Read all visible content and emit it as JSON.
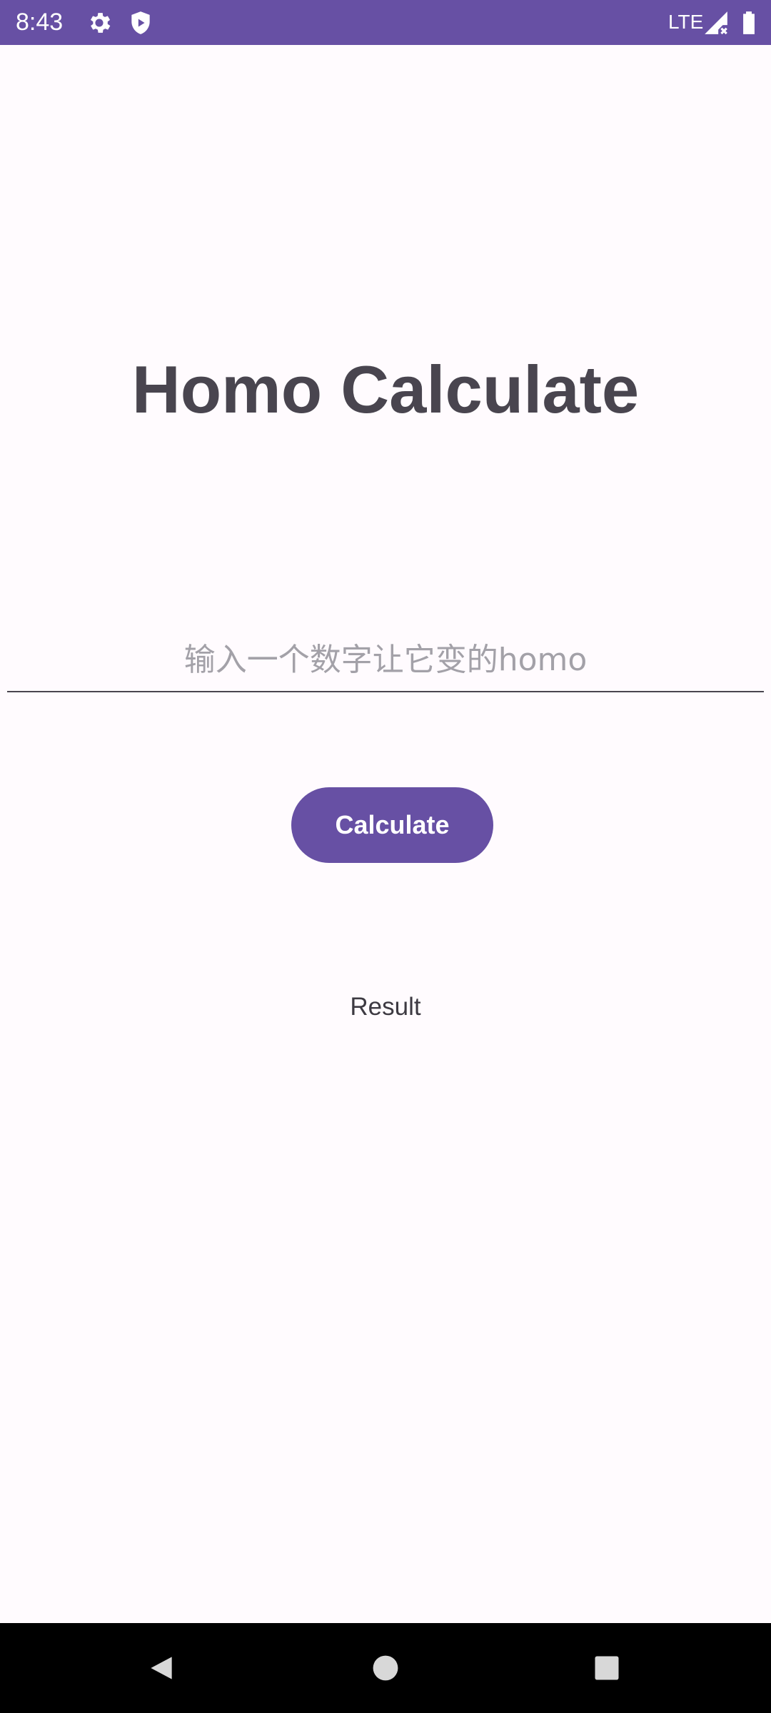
{
  "status_bar": {
    "time": "8:43",
    "network": "LTE",
    "icons": [
      "gear-icon",
      "shield-play-icon",
      "signal-icon",
      "battery-icon"
    ]
  },
  "main": {
    "title": "Homo Calculate",
    "input": {
      "placeholder": "输入一个数字让它变的homo",
      "value": ""
    },
    "calculate_label": "Calculate",
    "result_text": "Result"
  },
  "nav_bar": {
    "icons": [
      "back-icon",
      "home-icon",
      "recents-icon"
    ]
  },
  "colors": {
    "accent": "#6750a4",
    "background": "#fffbfe",
    "title": "#49454f",
    "placeholder": "#a3a1a8"
  }
}
